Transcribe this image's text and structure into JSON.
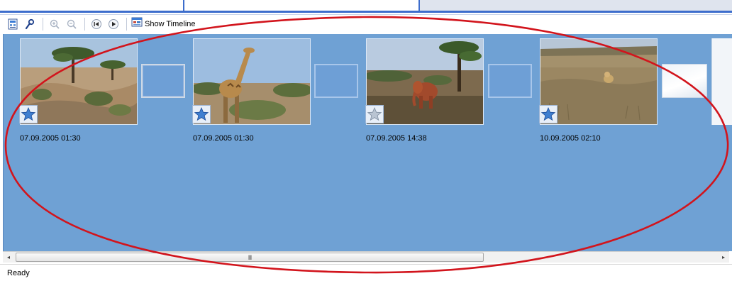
{
  "toolbar": {
    "show_timeline_label": "Show Timeline",
    "icons": [
      "storyboard-icon",
      "effects-icon",
      "zoom-in-icon",
      "zoom-out-icon",
      "rewind-icon",
      "play-icon",
      "timeline-icon"
    ]
  },
  "storyboard": {
    "clips": [
      {
        "date": "07.09.2005 01:30",
        "scene": "acacia trees on savanna"
      },
      {
        "date": "07.09.2005 01:30",
        "scene": "giraffe walking"
      },
      {
        "date": "07.09.2005 14:38",
        "scene": "elephant among trees"
      },
      {
        "date": "10.09.2005 02:10",
        "scene": "lion in tall grass"
      }
    ]
  },
  "scrollbar": {
    "left_arrow": "◂",
    "right_arrow": "▸",
    "grip": "III",
    "position": 0.0
  },
  "status": {
    "text": "Ready"
  },
  "colors": {
    "board_bg": "#6fa1d4",
    "annotation": "#d2141c",
    "accent": "#3d6dcc"
  }
}
